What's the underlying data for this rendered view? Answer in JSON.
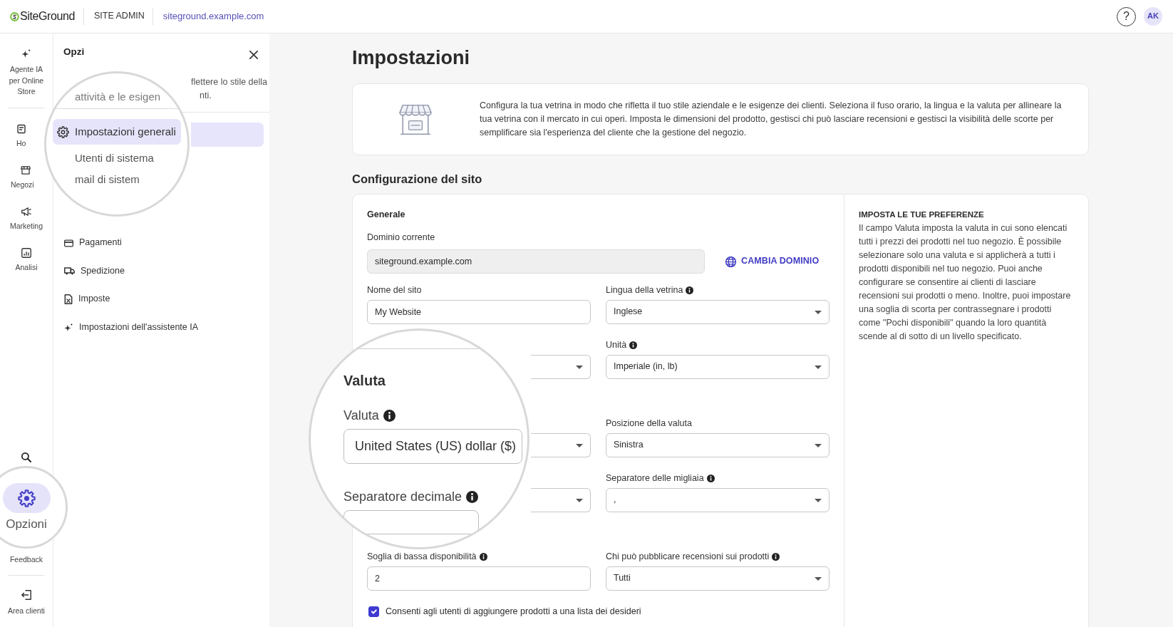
{
  "topbar": {
    "logo": "SiteGround",
    "section": "SITE ADMIN",
    "site": "siteground.example.com",
    "help": "?",
    "avatar": "AK"
  },
  "rail": {
    "items": [
      {
        "label": "Agente IA per Online Store",
        "selected": false
      },
      {
        "label": "Ho",
        "selected": false
      },
      {
        "label": "Negozi",
        "selected": false
      },
      {
        "label": "Marketing",
        "selected": false
      },
      {
        "label": "Analisi",
        "selected": false
      }
    ],
    "footer": [
      {
        "kind": "icon_button"
      },
      {
        "kind": "magnified",
        "label": "Opzioni",
        "selected": true
      },
      {
        "kind": "link",
        "label": "Feedback",
        "selected": false
      },
      {
        "kind": "link",
        "label": "Area clienti",
        "selected": false
      }
    ]
  },
  "panel": {
    "title": "Opzi",
    "description_lines": [
      "flettere lo stile della",
      "nti."
    ],
    "magnifier": {
      "description": "attività e le esigen",
      "items": [
        {
          "label": "Impostazioni generali",
          "selected": true
        },
        {
          "label": "Utenti di sistema",
          "selected": false
        },
        {
          "label": "mail di sistem",
          "selected": false
        }
      ]
    },
    "items": [
      {
        "label": "Pagamenti",
        "selected": false
      },
      {
        "label": "Spedizione",
        "selected": false
      },
      {
        "label": "Imposte",
        "selected": false
      },
      {
        "label": "Impostazioni dell'assistente IA",
        "selected": false
      }
    ]
  },
  "page": {
    "title": "Impostazioni",
    "intro": "Configura la tua vetrina in modo che rifletta il tuo stile aziendale e le esigenze dei clienti. Seleziona il fuso orario, la lingua e la valuta per allineare la tua vetrina con il mercato in cui operi. Imposta le dimensioni del prodotto, gestisci chi può lasciare recensioni e gestisci la visibilità delle scorte per semplificare sia l'esperienza del cliente che la gestione del negozio.",
    "section_title": "Configurazione del sito"
  },
  "form": {
    "group_title": "Generale",
    "domain": {
      "label": "Dominio corrente",
      "value": "siteground.example.com",
      "disabled": true,
      "action": "CAMBIA DOMINIO"
    },
    "rows": [
      {
        "left": {
          "label": "Nome del sito",
          "info": false,
          "kind": "input",
          "value": "My Website"
        },
        "right": {
          "label": "Lingua della vetrina",
          "info": true,
          "kind": "select",
          "value": "Inglese"
        }
      },
      {
        "left": {
          "kind": "select"
        },
        "right": {
          "label": "Unità",
          "info": true,
          "kind": "select",
          "value": "Imperiale (in, lb)"
        }
      },
      {
        "left": {
          "kind": "select"
        },
        "right": {
          "label": "Posizione della valuta",
          "info": false,
          "kind": "select",
          "value": "Sinistra"
        }
      },
      {
        "left": {
          "kind": "select"
        },
        "right": {
          "label": "Separatore delle migliaia",
          "info": true,
          "kind": "select",
          "value": ","
        }
      },
      {
        "left": {
          "label": "Soglia di bassa disponibilità",
          "info": true,
          "kind": "input",
          "value": "2"
        },
        "right": {
          "label": "Chi può pubblicare recensioni sui prodotti",
          "info": true,
          "kind": "select",
          "value": "Tutti"
        }
      }
    ],
    "magnifier": {
      "items": [
        {
          "kind": "heading",
          "text": "Valuta"
        },
        {
          "kind": "label",
          "text": "Valuta",
          "info": true
        },
        {
          "kind": "select",
          "value": "United States (US) dollar ($)"
        },
        {
          "kind": "label",
          "text": "Separatore decimale",
          "info": true
        },
        {
          "kind": "input"
        }
      ]
    },
    "checkbox": {
      "label": "Consenti agli utenti di aggiungere prodotti a una lista dei desideri",
      "checked": true
    }
  },
  "help": {
    "title": "IMPOSTA LE TUE PREFERENZE",
    "text": "Il campo Valuta imposta la valuta in cui sono elencati tutti i prezzi dei prodotti nel tuo negozio. È possibile selezionare solo una valuta e si applicherà a tutti i prodotti disponibili nel tuo negozio. Puoi anche configurare se consentire ai clienti di lasciare recensioni sui prodotti o meno. Inoltre, puoi impostare una soglia di scorta per contrassegnare i prodotti come \"Pochi disponibili\" quando la loro quantità scende al di sotto di un livello specificato."
  }
}
